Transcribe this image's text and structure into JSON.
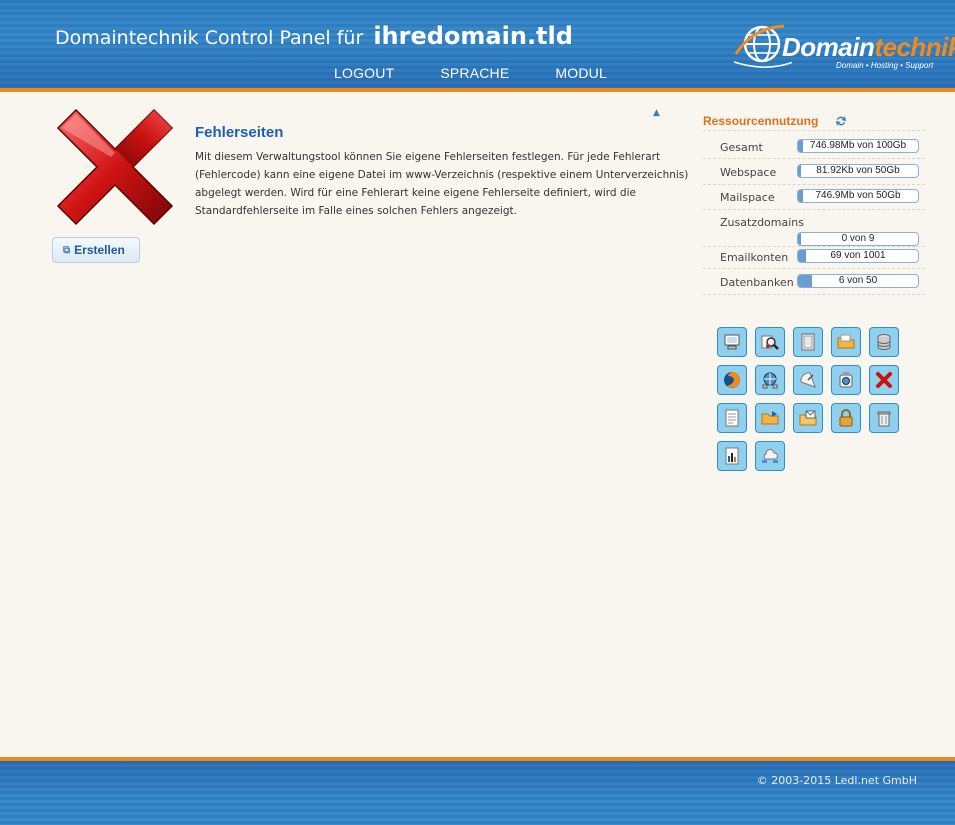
{
  "header": {
    "title_prefix": "Domaintechnik Control Panel für",
    "domain": "ihredomain.tld",
    "nav": [
      "LOGOUT",
      "SPRACHE",
      "MODUL"
    ],
    "logo_part1": "Domain",
    "logo_part2": "technik",
    "logo_tagline": "Domain  •  Hosting  •  Support"
  },
  "main": {
    "title": "Fehlerseiten",
    "description": "Mit diesem Verwaltungstool können Sie eigene Fehlerseiten festlegen. Für jede Fehlerart (Fehlercode) kann eine eigene Datei im www-Verzeichnis (respektive einem Unterverzeichnis) abgelegt werden. Wird für eine Fehlerart keine eigene Fehlerseite definiert, wird die Standardfehlerseite im Falle eines solchen Fehlers angezeigt.",
    "create_button": "Erstellen"
  },
  "resources": {
    "title": "Ressourcennutzung",
    "items": [
      {
        "label": "Gesamt",
        "value": "746.98Mb von 100Gb",
        "fraction": 0.007
      },
      {
        "label": "Webspace",
        "value": "81.92Kb von 50Gb",
        "fraction": 0.0
      },
      {
        "label": "Mailspace",
        "value": "746.9Mb von 50Gb",
        "fraction": 0.015
      },
      {
        "label": "Zusatzdomains",
        "value": "0 von 9",
        "fraction": 0.0
      },
      {
        "label": "Emailkonten",
        "value": "69 von 1001",
        "fraction": 0.069
      },
      {
        "label": "Datenbanken",
        "value": "6 von 50",
        "fraction": 0.12
      }
    ]
  },
  "tools": [
    "computer-icon",
    "search-tool-icon",
    "document-frame-icon",
    "folder-icon",
    "database-icon",
    "firefox-icon",
    "network-globe-icon",
    "satellite-icon",
    "backup-icon",
    "red-x-icon",
    "text-document-icon",
    "folder-transfer-icon",
    "mail-folder-icon",
    "lock-icon",
    "bin-icon",
    "statistics-icon",
    "cloud-network-icon"
  ],
  "footer": {
    "copyright": "© 2003-2015 Ledl.net GmbH"
  },
  "colors": {
    "header_blue": "#2f80c1",
    "accent_orange": "#f0851a",
    "title_blue": "#1d5fb0",
    "tool_bg": "#8fd0ee"
  }
}
